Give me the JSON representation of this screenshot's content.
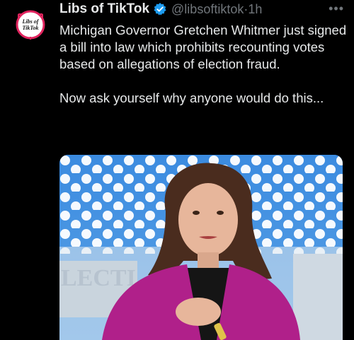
{
  "author": {
    "display_name": "Libs of TikTok",
    "handle": "@libsoftiktok",
    "separator": "·",
    "time": "1h",
    "avatar_text": "Libs of TikTok",
    "verified_icon": "verified-badge-icon"
  },
  "tweet": {
    "paragraphs": [
      "Michigan Governor Gretchen Whitmer just signed a bill into law which prohibits recounting votes based on allegations of election fraud.",
      "Now ask yourself why anyone would do this..."
    ]
  },
  "menu": {
    "more_label": "•••"
  },
  "media": {
    "background_text": "LECTI"
  },
  "colors": {
    "background": "#000000",
    "text": "#e7e9ea",
    "muted": "#71767b",
    "verified": "#1d9bf0",
    "avatar_ring": "#e0245e"
  }
}
